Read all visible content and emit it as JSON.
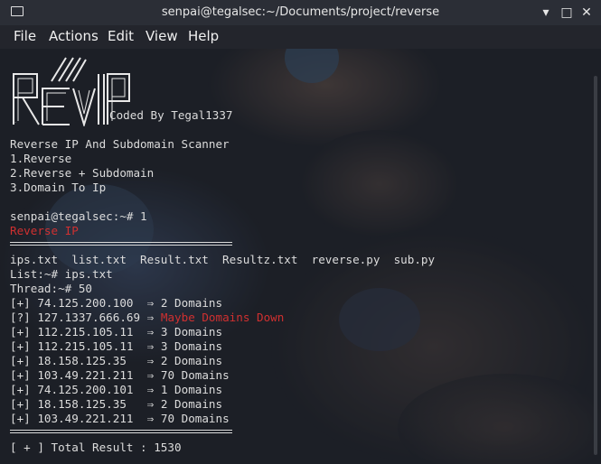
{
  "window": {
    "title": "senpai@tegalsec:~/Documents/project/reverse",
    "minimize_glyph": "▾",
    "maximize_glyph": "□",
    "close_glyph": "✕"
  },
  "menu": {
    "items": [
      "File",
      "Actions",
      "Edit",
      "View",
      "Help"
    ]
  },
  "terminal": {
    "logo_text": "REVIP",
    "coded_by": "Coded By Tegal1337",
    "heading": "Reverse IP And Subdomain Scanner",
    "options": [
      "1.Reverse",
      "2.Reverse + Subdomain",
      "3.Domain To Ip"
    ],
    "prompt_choice": "senpai@tegalsec:~# 1",
    "mode_label": "Reverse IP",
    "ls_output": "ips.txt  list.txt  Result.txt  Resultz.txt  reverse.py  sub.py",
    "list_prompt": "List:~# ips.txt",
    "thread_prompt": "Thread:~# 50",
    "results": [
      {
        "tag": "[+]",
        "ip": "74.125.200.100 ",
        "arrow": "⇒",
        "text": "2 Domains",
        "alert": false
      },
      {
        "tag": "[?]",
        "ip": "127.1337.666.69",
        "arrow": "⇒",
        "text": "Maybe Domains Down",
        "alert": true
      },
      {
        "tag": "[+]",
        "ip": "112.215.105.11 ",
        "arrow": "⇒",
        "text": "3 Domains",
        "alert": false
      },
      {
        "tag": "[+]",
        "ip": "112.215.105.11 ",
        "arrow": "⇒",
        "text": "3 Domains",
        "alert": false
      },
      {
        "tag": "[+]",
        "ip": "18.158.125.35  ",
        "arrow": "⇒",
        "text": "2 Domains",
        "alert": false
      },
      {
        "tag": "[+]",
        "ip": "103.49.221.211 ",
        "arrow": "⇒",
        "text": "70 Domains",
        "alert": false
      },
      {
        "tag": "[+]",
        "ip": "74.125.200.101 ",
        "arrow": "⇒",
        "text": "1 Domains",
        "alert": false
      },
      {
        "tag": "[+]",
        "ip": "18.158.125.35  ",
        "arrow": "⇒",
        "text": "2 Domains",
        "alert": false
      },
      {
        "tag": "[+]",
        "ip": "103.49.221.211 ",
        "arrow": "⇒",
        "text": "70 Domains",
        "alert": false
      }
    ],
    "total": "[ + ] Total Result : 1530"
  },
  "colors": {
    "alert": "#d03030",
    "text": "#dcdcdc",
    "background": "#1c1f26"
  }
}
